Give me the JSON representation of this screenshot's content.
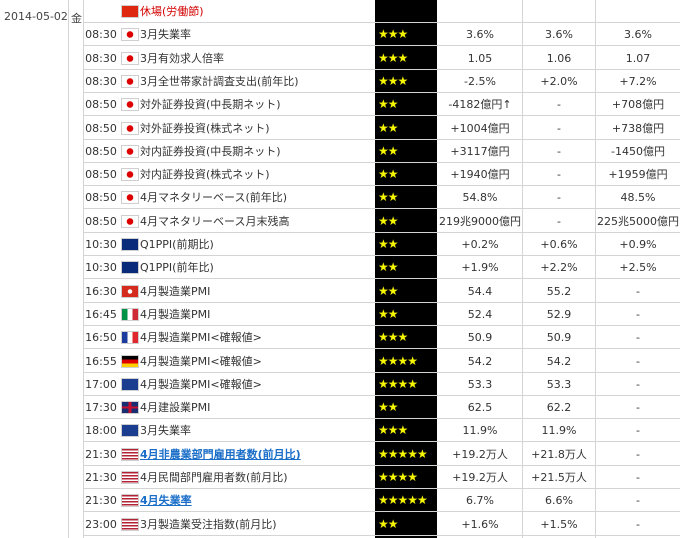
{
  "date": "2014-05-02",
  "dow": "金",
  "rows": [
    {
      "time": "",
      "flag": "cn",
      "name": "休場(労働節)",
      "style": "holiday",
      "stars": "",
      "v1": "",
      "v2": "",
      "v3": ""
    },
    {
      "time": "08:30",
      "flag": "jp",
      "name": "3月失業率",
      "style": "",
      "stars": "★★★",
      "v1": "3.6%",
      "v2": "3.6%",
      "v3": "3.6%"
    },
    {
      "time": "08:30",
      "flag": "jp",
      "name": "3月有効求人倍率",
      "style": "",
      "stars": "★★★",
      "v1": "1.05",
      "v2": "1.06",
      "v3": "1.07"
    },
    {
      "time": "08:30",
      "flag": "jp",
      "name": "3月全世帯家計調査支出(前年比)",
      "style": "",
      "stars": "★★★",
      "v1": "-2.5%",
      "v2": "+2.0%",
      "v3": "+7.2%"
    },
    {
      "time": "08:50",
      "flag": "jp",
      "name": "対外証券投資(中長期ネット)",
      "style": "",
      "stars": "★★",
      "v1": "-4182億円↑",
      "v2": "-",
      "v3": "+708億円"
    },
    {
      "time": "08:50",
      "flag": "jp",
      "name": "対外証券投資(株式ネット)",
      "style": "",
      "stars": "★★",
      "v1": "+1004億円",
      "v2": "-",
      "v3": "+738億円"
    },
    {
      "time": "08:50",
      "flag": "jp",
      "name": "対内証券投資(中長期ネット)",
      "style": "",
      "stars": "★★",
      "v1": "+3117億円",
      "v2": "-",
      "v3": "-1450億円"
    },
    {
      "time": "08:50",
      "flag": "jp",
      "name": "対内証券投資(株式ネット)",
      "style": "",
      "stars": "★★",
      "v1": "+1940億円",
      "v2": "-",
      "v3": "+1959億円"
    },
    {
      "time": "08:50",
      "flag": "jp",
      "name": "4月マネタリーベース(前年比)",
      "style": "",
      "stars": "★★",
      "v1": "54.8%",
      "v2": "-",
      "v3": "48.5%"
    },
    {
      "time": "08:50",
      "flag": "jp",
      "name": "4月マネタリーベース月末残高",
      "style": "",
      "stars": "★★",
      "v1": "219兆9000億円",
      "v2": "-",
      "v3": "225兆5000億円"
    },
    {
      "time": "10:30",
      "flag": "au",
      "name": "Q1PPI(前期比)",
      "style": "",
      "stars": "★★",
      "v1": "+0.2%",
      "v2": "+0.6%",
      "v3": "+0.9%"
    },
    {
      "time": "10:30",
      "flag": "au",
      "name": "Q1PPI(前年比)",
      "style": "",
      "stars": "★★",
      "v1": "+1.9%",
      "v2": "+2.2%",
      "v3": "+2.5%"
    },
    {
      "time": "16:30",
      "flag": "ch",
      "name": "4月製造業PMI",
      "style": "",
      "stars": "★★",
      "v1": "54.4",
      "v2": "55.2",
      "v3": "-"
    },
    {
      "time": "16:45",
      "flag": "it",
      "name": "4月製造業PMI",
      "style": "",
      "stars": "★★",
      "v1": "52.4",
      "v2": "52.9",
      "v3": "-"
    },
    {
      "time": "16:50",
      "flag": "fr",
      "name": "4月製造業PMI<確報値>",
      "style": "",
      "stars": "★★★",
      "v1": "50.9",
      "v2": "50.9",
      "v3": "-"
    },
    {
      "time": "16:55",
      "flag": "de",
      "name": "4月製造業PMI<確報値>",
      "style": "",
      "stars": "★★★★",
      "v1": "54.2",
      "v2": "54.2",
      "v3": "-"
    },
    {
      "time": "17:00",
      "flag": "eu",
      "name": "4月製造業PMI<確報値>",
      "style": "",
      "stars": "★★★★",
      "v1": "53.3",
      "v2": "53.3",
      "v3": "-"
    },
    {
      "time": "17:30",
      "flag": "uk",
      "name": "4月建設業PMI",
      "style": "",
      "stars": "★★",
      "v1": "62.5",
      "v2": "62.2",
      "v3": "-"
    },
    {
      "time": "18:00",
      "flag": "eu",
      "name": "3月失業率",
      "style": "",
      "stars": "★★★",
      "v1": "11.9%",
      "v2": "11.9%",
      "v3": "-"
    },
    {
      "time": "21:30",
      "flag": "us",
      "name": "4月非農業部門雇用者数(前月比)",
      "style": "link",
      "stars": "★★★★★",
      "v1": "+19.2万人",
      "v2": "+21.8万人",
      "v3": "-"
    },
    {
      "time": "21:30",
      "flag": "us",
      "name": "4月民間部門雇用者数(前月比)",
      "style": "",
      "stars": "★★★★",
      "v1": "+19.2万人",
      "v2": "+21.5万人",
      "v3": "-"
    },
    {
      "time": "21:30",
      "flag": "us",
      "name": "4月失業率",
      "style": "link",
      "stars": "★★★★★",
      "v1": "6.7%",
      "v2": "6.6%",
      "v3": "-"
    },
    {
      "time": "23:00",
      "flag": "us",
      "name": "3月製造業受注指数(前月比)",
      "style": "",
      "stars": "★★",
      "v1": "+1.6%",
      "v2": "+1.5%",
      "v3": "-"
    }
  ]
}
